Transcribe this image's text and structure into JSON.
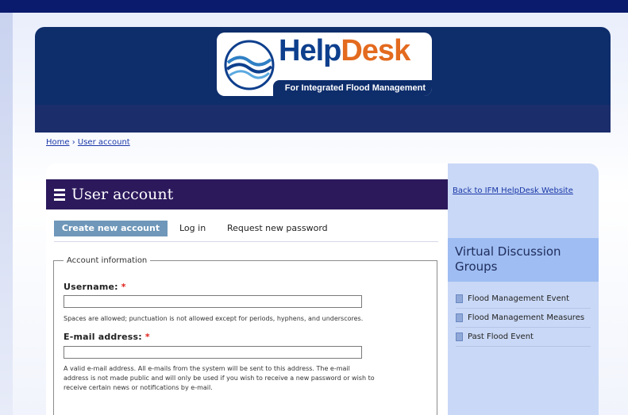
{
  "logo": {
    "help": "Help",
    "desk": "Desk",
    "tagline": "For Integrated Flood Management"
  },
  "breadcrumb": {
    "home": "Home",
    "separator": "›",
    "current": "User account"
  },
  "page": {
    "title": "User account"
  },
  "tabs": [
    {
      "label": "Create new account",
      "active": true
    },
    {
      "label": "Log in",
      "active": false
    },
    {
      "label": "Request new password",
      "active": false
    }
  ],
  "form": {
    "legend": "Account information",
    "username": {
      "label": "Username:",
      "required_mark": "*",
      "value": "",
      "description": "Spaces are allowed; punctuation is not allowed except for periods, hyphens, and underscores."
    },
    "email": {
      "label": "E-mail address:",
      "required_mark": "*",
      "value": "",
      "description_lines": [
        "A valid e-mail address. All e-mails from the system will be sent to this address. The e-mail",
        "address is not made public and will only be used if you wish to receive a new password or wish to",
        "receive certain news or notifications by e-mail."
      ]
    }
  },
  "sidebar": {
    "back_link": "Back to IFM HelpDesk Website",
    "vdg_title": "Virtual Discussion Groups",
    "items": [
      {
        "label": "Flood Management Event"
      },
      {
        "label": "Flood Management Measures"
      },
      {
        "label": "Past Flood Event"
      }
    ]
  },
  "colors": {
    "header": "#0e2d6b",
    "title_bar": "#2c195c",
    "active_tab": "#6e97b9",
    "sidebar": "#c9d8f6",
    "vdg_box": "#9fbdf2",
    "link": "#1a38a8",
    "logo_orange": "#e36a1e",
    "required": "#e0201a"
  }
}
